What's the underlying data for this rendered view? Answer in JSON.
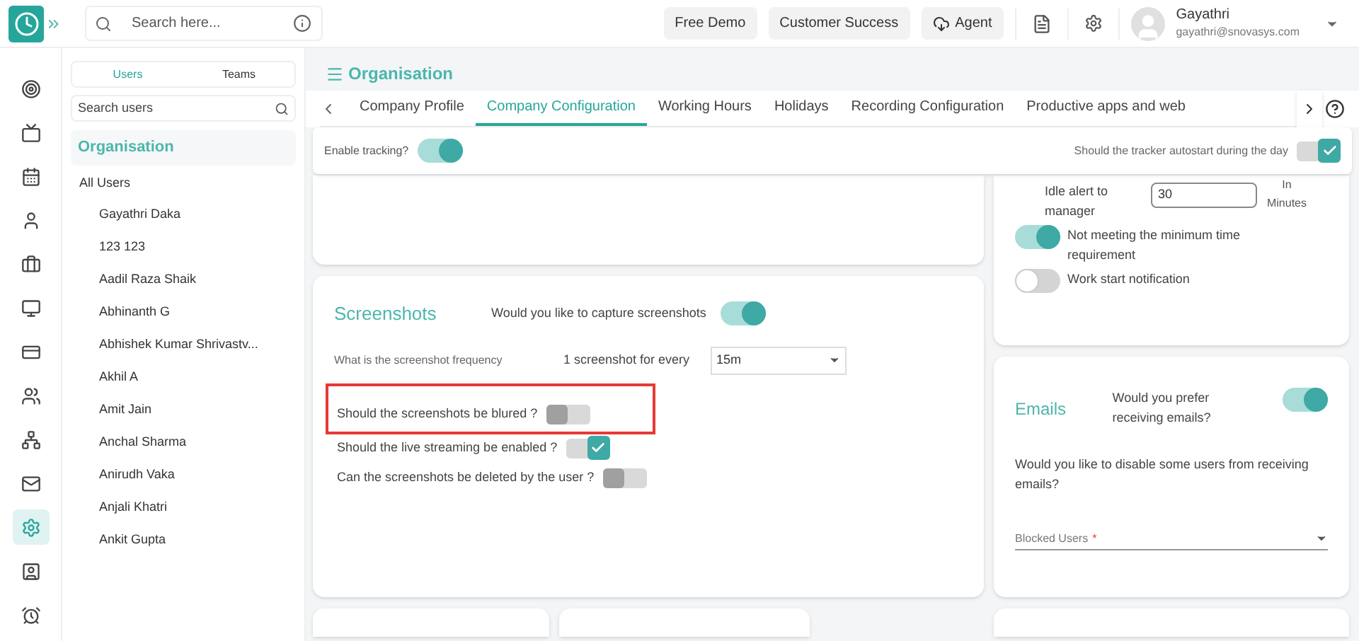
{
  "topbar": {
    "search": {
      "placeholder": "Search here..."
    },
    "buttons": [
      {
        "label": "Free Demo",
        "kind": "plain"
      },
      {
        "label": "Customer Success",
        "kind": "plain"
      },
      {
        "label": "Agent",
        "kind": "cloud"
      }
    ],
    "user": {
      "name": "Gayathri",
      "email": "gayathri@snovasys.com"
    }
  },
  "rail": [
    {
      "selected": false
    },
    {
      "selected": false
    },
    {
      "selected": false
    },
    {
      "selected": false
    },
    {
      "selected": false
    },
    {
      "selected": false
    },
    {
      "selected": false
    },
    {
      "selected": false
    },
    {
      "selected": false
    },
    {
      "selected": false
    },
    {
      "selected": true
    },
    {
      "selected": false
    },
    {
      "selected": false
    }
  ],
  "users_panel": {
    "tabs": [
      {
        "label": "Users",
        "selected": true
      },
      {
        "label": "Teams",
        "selected": false
      }
    ],
    "search": {
      "placeholder": "Search users"
    },
    "group": "Organisation",
    "all": "All Users",
    "users": [
      "Gayathri Daka",
      "123 123",
      "Aadil Raza Shaik",
      "Abhinanth G",
      "Abhishek Kumar Shrivastv...",
      "Akhil A",
      "Amit Jain",
      "Anchal Sharma",
      "Anirudh Vaka",
      "Anjali Khatri",
      "Ankit Gupta"
    ]
  },
  "page": {
    "title": "Organisation",
    "tabs": [
      {
        "label": "Company Profile",
        "selected": false
      },
      {
        "label": "Company Configuration",
        "selected": true
      },
      {
        "label": "Working Hours",
        "selected": false
      },
      {
        "label": "Holidays",
        "selected": false
      },
      {
        "label": "Recording Configuration",
        "selected": false
      },
      {
        "label": "Productive apps and web",
        "selected": false
      }
    ]
  },
  "tracking": {
    "enable": {
      "label": "Enable tracking?",
      "on": true,
      "kind": "switch"
    },
    "autostart": {
      "label": "Should the tracker autostart during the day",
      "on": true,
      "kind": "check"
    }
  },
  "screenshots": {
    "title": "Screenshots",
    "capture": {
      "label": "Would you like to capture screenshots",
      "on": true,
      "kind": "switch"
    },
    "frequency_label": "What is the screenshot frequency",
    "every_label": "1 screenshot for every",
    "frequency": "15m",
    "options": [
      {
        "label": "Should the screenshots be blured ?",
        "on": false,
        "kind": "check",
        "highlighted": true
      },
      {
        "label": "Should the live streaming be enabled ?",
        "on": true,
        "kind": "check",
        "highlighted": false
      },
      {
        "label": "Can the screenshots be deleted by the user ?",
        "on": false,
        "kind": "check",
        "highlighted": false
      }
    ]
  },
  "alerts": {
    "idle": {
      "label": "Idle alert to manager",
      "value": "30",
      "unit": "In Minutes"
    },
    "toggles": [
      {
        "label": "Not meeting the minimum time requirement",
        "on": true,
        "kind": "switch"
      },
      {
        "label": "Work start notification",
        "on": false,
        "kind": "switch"
      }
    ]
  },
  "emails": {
    "title": "Emails",
    "prefer": {
      "label": "Would you prefer receiving emails?",
      "on": true,
      "kind": "switch"
    },
    "question": "Would you like to disable some users from receiving emails?",
    "blocked": {
      "label": "Blocked Users",
      "required_mark": "*"
    }
  }
}
